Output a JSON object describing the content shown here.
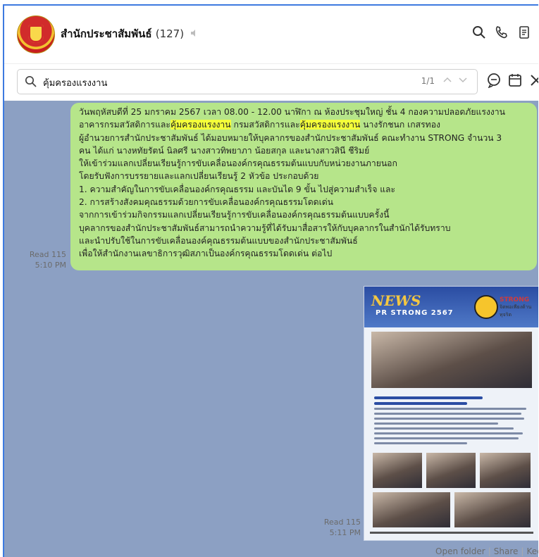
{
  "chat": {
    "name": "สำนักประชาสัมพันธ์",
    "member_count": "(127)"
  },
  "search": {
    "query": "คุ้มครองแรงงาน",
    "result_count": "1/1"
  },
  "header_icons": [
    "search-icon",
    "phone-icon",
    "notes-icon"
  ],
  "searchbar_icons": [
    "chat-bubble-icon",
    "calendar-icon",
    "close-icon"
  ],
  "messages": [
    {
      "type": "text",
      "lines": [
        {
          "text": "วันพฤหัสบดีที่ 25 มกราคม 2567 เวลา 08.00 - 12.00 นาฬิกา  ณ ห้องประชุมใหญ่ ชั้น 4 กองความปลอดภัยแรงงาน"
        },
        {
          "parts": [
            "อาคารกรมสวัสดิการและ",
            "คุ้มครองแรงงาน",
            " กรมสวัสดิการและ",
            "คุ้มครองแรงงาน",
            " นางรักชนก  เกสรทอง"
          ]
        },
        {
          "text": "ผู้อำนวยการสำนักประชาสัมพันธ์ ได้มอบหมายให้บุคลากรของสำนักประชาสัมพันธ์ คณะทำงาน STRONG  จำนวน 3"
        },
        {
          "text": "คน ได้แก่ นางหทัยรัตน์  นิลศรี นางสาวทิพยาภา น้อยสกุล และนางสาวสินี ชีริมย์"
        },
        {
          "text": "ให้เข้าร่วมแลกเปลี่ยนเรียนรู้การขับเคลื่อนองค์กรคุณธรรมต้นแบบกับหน่วยงานภายนอก"
        },
        {
          "text": "โดยรับฟังการบรรยายและแลกเปลี่ยนเรียนรู้ 2 หัวข้อ ประกอบด้วย"
        },
        {
          "text": "1. ความสำคัญในการขับเคลื่อนองค์กรคุณธรรม และบันได 9 ขั้น ไปสู่ความสำเร็จ และ"
        },
        {
          "text": "2. การสร้างสังคมคุณธรรมด้วยการขับเคลื่อนองค์กรคุณธรรมโดดเด่น"
        },
        {
          "text": "จากการเข้าร่วมกิจกรรมแลกเปลี่ยนเรียนรู้การขับเคลื่อนองค์กรคุณธรรมต้นแบบครั้งนี้"
        },
        {
          "text": "บุคลากรของสำนักประชาสัมพันธ์สามารถนำความรู้ที่ได้รับมาสื่อสารให้กับบุคลากรในสำนักได้รับทราบ"
        },
        {
          "text": "และนำปรับใช้ในการขับเคลื่อนองค์คุณธรรมต้นแบบของสำนักประชาสัมพันธ์"
        },
        {
          "text": "เพื่อให้สำนักงานเลขาธิการวุฒิสภาเป็นองค์กรคุณธรรมโดดเด่น ต่อไป"
        }
      ],
      "read": "Read 115",
      "time": "5:10 PM"
    },
    {
      "type": "image",
      "poster_title": "NEWS",
      "poster_subtitle": "PR STRONG 2567",
      "poster_logo_text": "STRONG",
      "poster_logo_caption": "จิตพอเพียงต้านทุจริต",
      "read": "Read 115",
      "time": "5:11 PM"
    }
  ],
  "image_actions": [
    "Open folder",
    "Share",
    "Keep"
  ]
}
